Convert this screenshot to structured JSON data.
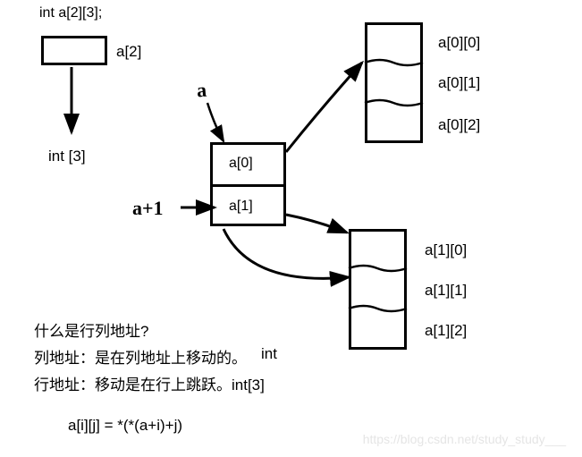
{
  "decl": "int a[2][3];",
  "top_left": {
    "box_label": "a[2]",
    "result": "int [3]"
  },
  "handwritten": {
    "a_label": "a",
    "a_plus_1": "a+1"
  },
  "middle_array": {
    "row0": "a[0]",
    "row1": "a[1]"
  },
  "right_top_array": {
    "cell0": "a[0][0]",
    "cell1": "a[0][1]",
    "cell2": "a[0][2]"
  },
  "right_bottom_array": {
    "cell0": "a[1][0]",
    "cell1": "a[1][1]",
    "cell2": "a[1][2]"
  },
  "question": "什么是行列地址?",
  "col_addr": "列地址：是在列地址上移动的。",
  "col_type": "int",
  "row_addr": "行地址：移动是在行上跳跃。int[3]",
  "formula": "a[i][j] = *(*(a+i)+j)",
  "watermark": "https://blog.csdn.net/study_study___"
}
